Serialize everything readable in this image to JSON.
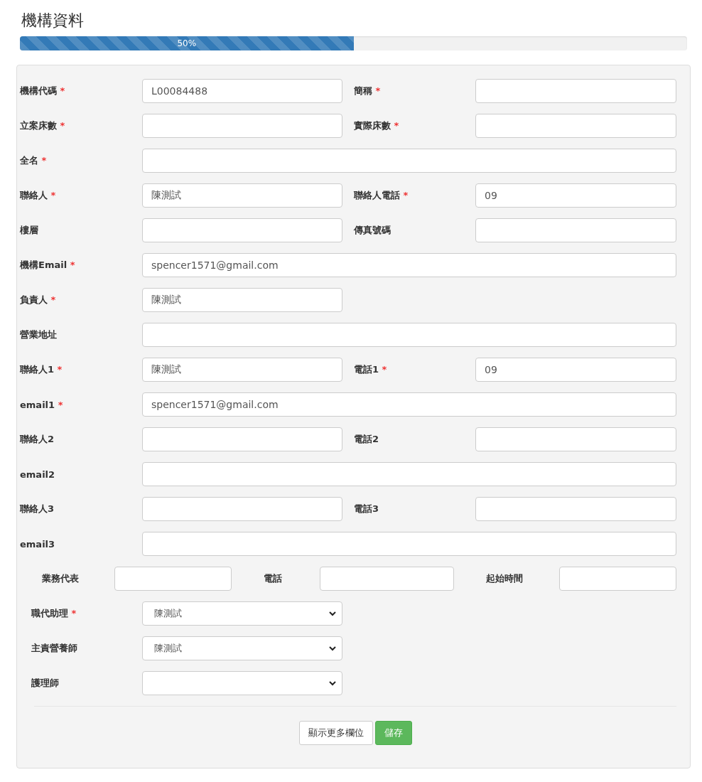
{
  "title": "機構資料",
  "progress": {
    "level": 0.5,
    "label": "50%"
  },
  "rows": [
    {
      "kind": "pair",
      "fields": [
        {
          "label": "機構代碼",
          "marker": "*",
          "value": "L00084488"
        },
        {
          "label": "簡稱",
          "marker": "*"
        }
      ]
    },
    {
      "kind": "pair",
      "fields": [
        {
          "label": "立案床數",
          "marker": "*"
        },
        {
          "label": "實際床數",
          "marker": "*"
        }
      ]
    },
    {
      "kind": "full",
      "fields": [
        {
          "label": "全名",
          "marker": "*"
        }
      ]
    },
    {
      "kind": "pair",
      "fields": [
        {
          "label": "聯絡人",
          "marker": "*",
          "value": "陳測試"
        },
        {
          "label": "聯絡人電話",
          "marker": "*",
          "value": "09"
        }
      ]
    },
    {
      "kind": "pair",
      "fields": [
        {
          "label": "樓層"
        },
        {
          "label": "傳真號碼"
        }
      ]
    },
    {
      "kind": "full",
      "fields": [
        {
          "label": "機構Email",
          "marker": "*",
          "value": "spencer1571@gmail.com"
        }
      ]
    },
    {
      "kind": "half",
      "fields": [
        {
          "label": "負責人",
          "marker": "*",
          "value": "陳測試"
        }
      ]
    },
    {
      "kind": "full",
      "fields": [
        {
          "label": "營業地址"
        }
      ]
    },
    {
      "kind": "pair",
      "fields": [
        {
          "label": "聯絡人1",
          "marker": "*",
          "value": "陳測試"
        },
        {
          "label": "電話1",
          "marker": "*",
          "value": "09"
        }
      ]
    },
    {
      "kind": "full",
      "fields": [
        {
          "label": "email1",
          "marker": "*",
          "value": "spencer1571@gmail.com"
        }
      ]
    },
    {
      "kind": "pair",
      "fields": [
        {
          "label": "聯絡人2"
        },
        {
          "label": "電話2"
        }
      ]
    },
    {
      "kind": "full",
      "fields": [
        {
          "label": "email2"
        }
      ]
    },
    {
      "kind": "pair",
      "fields": [
        {
          "label": "聯絡人3"
        },
        {
          "label": "電話3"
        }
      ]
    },
    {
      "kind": "full",
      "fields": [
        {
          "label": "email3"
        }
      ]
    },
    {
      "kind": "trio",
      "fields": [
        {
          "label": "業務代表"
        },
        {
          "label": "電話"
        },
        {
          "label": "起始時間"
        }
      ]
    },
    {
      "kind": "select",
      "fields": [
        {
          "label": "職代助理",
          "marker": "*",
          "value": "陳測試"
        }
      ]
    },
    {
      "kind": "select",
      "fields": [
        {
          "label": "主責營養師",
          "value": "陳測試"
        }
      ]
    },
    {
      "kind": "select",
      "fields": [
        {
          "label": "護理師"
        }
      ]
    }
  ],
  "buttons": [
    {
      "label": "顯示更多欄位",
      "kind": "default"
    },
    {
      "label": "儲存",
      "kind": "success"
    }
  ]
}
